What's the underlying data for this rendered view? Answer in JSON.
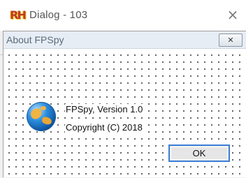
{
  "window": {
    "title": "Dialog - 103",
    "logo_text": "RH",
    "close_glyph": "×"
  },
  "dialog": {
    "title": "About FPSpy",
    "close_glyph": "✕",
    "icon": "globe-icon",
    "lines": [
      "FPSpy, Version 1.0",
      "Copyright (C) 2018"
    ],
    "ok_label": "OK"
  },
  "colors": {
    "focus_border": "#3c7fd6",
    "dialog_titlebar": "#e7edf5"
  }
}
